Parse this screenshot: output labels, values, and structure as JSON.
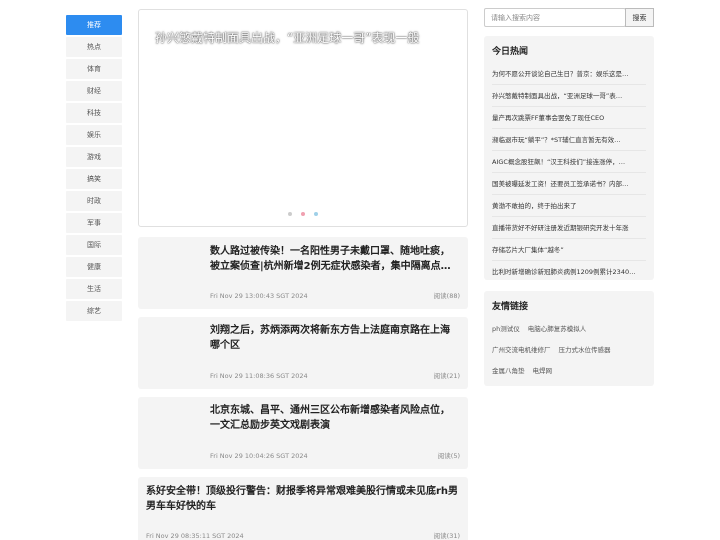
{
  "nav": [
    "推荐",
    "热点",
    "体育",
    "财经",
    "科技",
    "娱乐",
    "游戏",
    "搞笑",
    "时政",
    "军事",
    "国际",
    "健康",
    "生活",
    "综艺"
  ],
  "carousel": {
    "title": "孙兴慜戴特制面具出战，“亚洲足球一哥”表现一般",
    "slide_count": 3,
    "active_slide": 1
  },
  "news": [
    {
      "title": "数人路过被传染！一名阳性男子未戴口罩、随地吐痰，被立案侦查|杭州新增2例无症状感染者，集中隔离点…",
      "date": "Fri Nov 29 13:00:43 SGT 2024",
      "reads": "阅读(88)"
    },
    {
      "title": "刘翔之后，苏炳添两次将新东方告上法庭南京路在上海哪个区",
      "date": "Fri Nov 29 11:08:36 SGT 2024",
      "reads": "阅读(21)"
    },
    {
      "title": "北京东城、昌平、通州三区公布新增感染者风险点位，一文汇总励步英文戏剧表演",
      "date": "Fri Nov 29 10:04:26 SGT 2024",
      "reads": "阅读(5)"
    },
    {
      "title": "系好安全带！顶级投行警告：财报季将异常艰难美股行情或未见底rh男男车车好快的车",
      "date": "Fri Nov 29 08:35:11 SGT 2024",
      "reads": "阅读(31)"
    }
  ],
  "search": {
    "placeholder": "请输入搜索内容",
    "button": "搜索"
  },
  "hot": {
    "title": "今日热闻",
    "items": [
      "为何不愿公开谈论自己生日？普京：娱乐这是…",
      "孙兴慜戴特制面具出战，“亚洲足球一哥”表…",
      "量产再次跳票FF董事会罢免了现任CEO",
      "濒临退市玩“躺平”？*ST辅仁直言暂无有效…",
      "AIGC概念股狂飙！“汉王科技们”接连涨停，…",
      "国美被曝延发工资！还要员工签承诺书？内部…",
      "黄渤不敢拍的，终于拍出来了",
      "直播带货好不好研注册发近期银研究开发十年涨",
      "存储芯片大厂集体“越冬”",
      "比利时新增确诊新冠肺炎病例1209例累计2340…"
    ]
  },
  "friends": {
    "title": "友情链接",
    "rows": [
      [
        "ph测试仪",
        "电脑心肺复苏模拟人"
      ],
      [
        "广州交流电机维修厂",
        "压力式水位传感器"
      ],
      [
        "金属八角垫",
        "电焊网"
      ]
    ]
  }
}
